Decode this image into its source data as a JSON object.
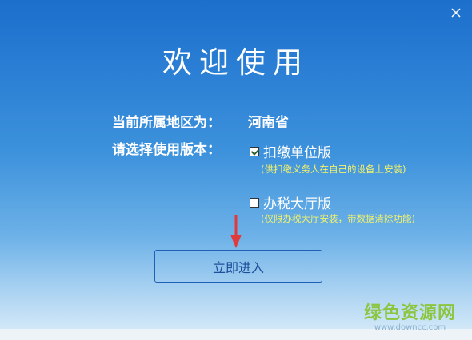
{
  "window": {
    "title": "欢迎使用"
  },
  "region": {
    "label": "当前所属地区为：",
    "value": "河南省"
  },
  "version": {
    "label": "请选择使用版本：",
    "options": [
      {
        "label": "扣缴单位版",
        "note": "(供扣缴义务人在自己的设备上安装)",
        "checked": true
      },
      {
        "label": "办税大厅版",
        "note": "(仅限办税大厅安装，带数据清除功能)",
        "checked": false
      }
    ]
  },
  "actions": {
    "start_label": "立即进入"
  },
  "watermark": {
    "text": "绿色资源网",
    "url": "www.downcc.com"
  },
  "colors": {
    "accent": "#1c6fcb",
    "note": "#f4f26a",
    "arrow": "#e03a3a",
    "watermark": "#8cc63f"
  },
  "icons": {
    "close": "close-icon",
    "arrow": "arrow-down-icon"
  }
}
